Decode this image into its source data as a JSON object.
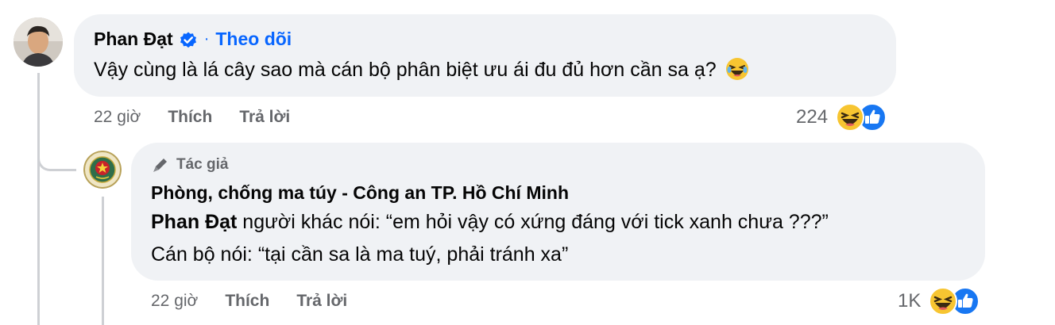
{
  "comment": {
    "author": "Phan Đạt",
    "verified_icon": "verified-badge-icon",
    "separator": "·",
    "follow_label": "Theo dõi",
    "text": "Vậy cùng là lá cây sao mà cán bộ phân biệt ưu ái đu đủ hơn cần sa ạ?",
    "time": "22 giờ",
    "like_label": "Thích",
    "reply_label": "Trả lời",
    "reaction_count": "224"
  },
  "reply": {
    "author_badge": "Tác giả",
    "author_badge_icon": "pen-icon",
    "page_name": "Phòng, chống ma túy - Công an TP. Hồ Chí Minh",
    "mention": "Phan Đạt",
    "line1_rest": " người khác nói: “em hỏi vậy có xứng đáng với tick xanh chưa ???”",
    "line2": "Cán bộ nói: “tại cần sa là ma tuý, phải tránh xa”",
    "time": "22 giờ",
    "like_label": "Thích",
    "reply_label": "Trả lời",
    "reaction_count": "1K"
  },
  "colors": {
    "bubble": "#f0f2f5",
    "link": "#0866ff",
    "secondary_text": "#65676b",
    "like_blue": "#1877f2",
    "haha_yellow": "#f7b125"
  }
}
